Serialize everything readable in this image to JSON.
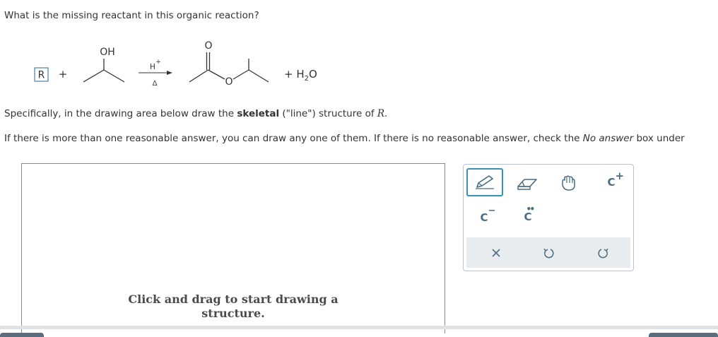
{
  "question": "What is the missing reactant in this organic reaction?",
  "reaction": {
    "r_label": "R",
    "plus": "+",
    "oh_label": "OH",
    "acid_label": "H",
    "acid_charge": "+",
    "heat_label": "Δ",
    "carbonyl_o": "O",
    "ester_o": "O",
    "plus_water": "+ H",
    "water_sub": "2",
    "water_o": "O"
  },
  "instructions": {
    "p1_prefix": "Specifically, in the drawing area below draw the ",
    "p1_bold": "skeletal",
    "p1_mid": " (\"line\") structure of ",
    "p1_var": "R",
    "p1_end": ".",
    "p2_prefix": "If there is more than one reasonable answer, you can draw any one of them. If there is no reasonable answer, check the ",
    "p2_italic": "No answer",
    "p2_suffix": " box under"
  },
  "canvas": {
    "hint_line1": "Click and drag to start drawing a",
    "hint_line2": "structure."
  },
  "toolbar": {
    "tools": [
      "pencil-icon",
      "eraser-icon",
      "hand-icon",
      "carbocation-icon",
      "carbanion-icon",
      "carbon-radical-icon"
    ],
    "carbocation_label": "C",
    "carbocation_charge": "+",
    "carbanion_label": "C",
    "carbanion_charge": "−",
    "radical_label": "C",
    "actions": [
      "clear-icon",
      "undo-icon",
      "redo-icon"
    ],
    "accent": "#3a8fb7"
  }
}
